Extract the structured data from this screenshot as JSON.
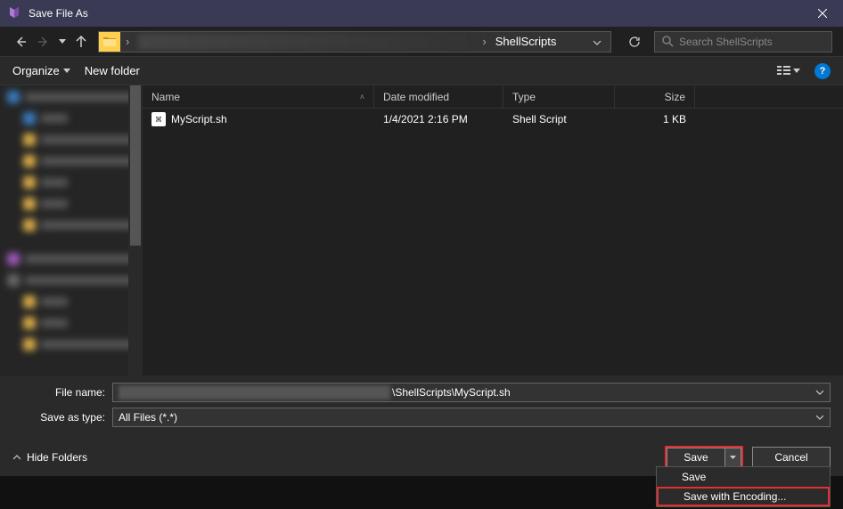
{
  "titlebar": {
    "title": "Save File As"
  },
  "address": {
    "segment": "ShellScripts"
  },
  "search": {
    "placeholder": "Search ShellScripts"
  },
  "toolbar": {
    "organize": "Organize",
    "newfolder": "New folder"
  },
  "columns": {
    "name": "Name",
    "date": "Date modified",
    "type": "Type",
    "size": "Size"
  },
  "files": [
    {
      "name": "MyScript.sh",
      "date": "1/4/2021 2:16 PM",
      "type": "Shell Script",
      "size": "1 KB"
    }
  ],
  "fields": {
    "filename_label": "File name:",
    "filename_visible": "\\ShellScripts\\MyScript.sh",
    "saveastype_label": "Save as type:",
    "saveastype_value": "All Files (*.*)"
  },
  "footer": {
    "hide_folders": "Hide Folders",
    "save": "Save",
    "cancel": "Cancel"
  },
  "dropdown": {
    "save": "Save",
    "save_encoding": "Save with Encoding..."
  }
}
